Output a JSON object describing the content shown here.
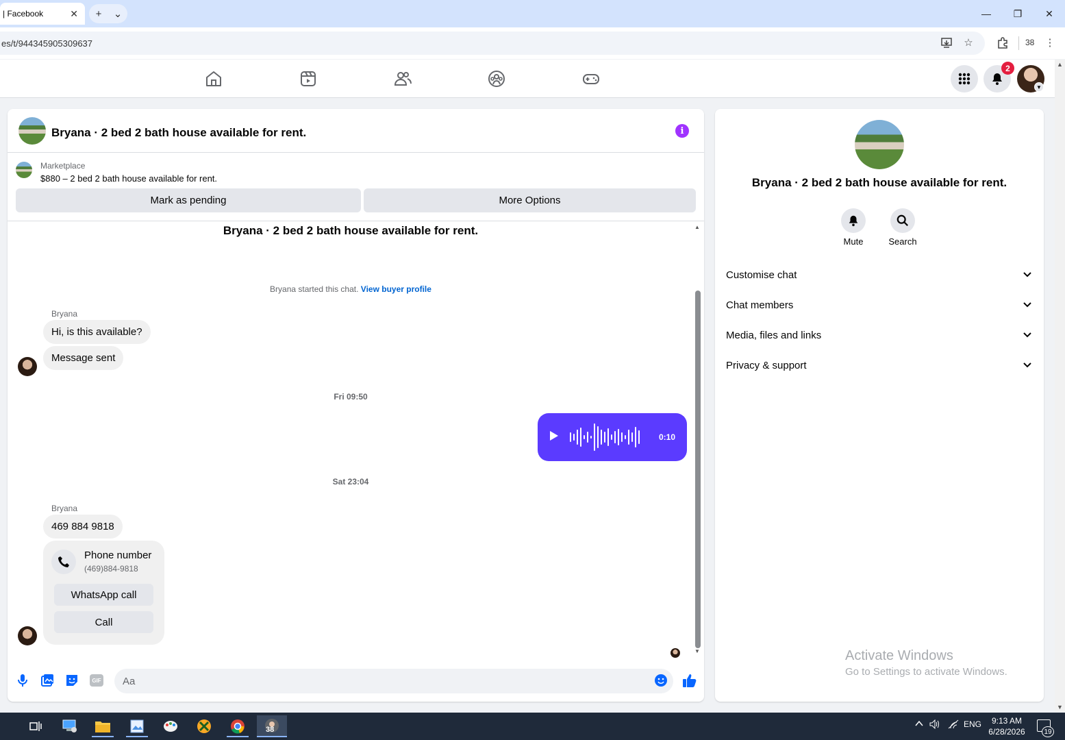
{
  "browser": {
    "tab_title": "| Facebook",
    "tab_close": "✕",
    "new_tab": "+",
    "tab_menu": "⌄",
    "url": "es/t/944345905309637",
    "extension_count": "38",
    "window_controls": {
      "minimize": "—",
      "restore": "❐",
      "close": "✕"
    }
  },
  "fb_nav": {
    "icons": [
      "home-icon",
      "video-icon",
      "friends-icon",
      "groups-icon",
      "gaming-icon"
    ],
    "notification_count": "2",
    "accent": "#0866ff"
  },
  "chat": {
    "title": "Bryana · 2 bed 2 bath house available for rent.",
    "marketplace_label": "Marketplace",
    "listing": "$880 – 2 bed 2 bath house available for rent.",
    "mark_pending": "Mark as pending",
    "more_options": "More Options",
    "conversation_title": "Bryana · 2 bed 2 bath house available for rent.",
    "started_text": "Bryana started this chat. ",
    "view_buyer_profile": "View buyer profile",
    "messages": [
      {
        "sender": "Bryana",
        "text": "Hi, is this available?"
      },
      {
        "text": "Message sent"
      }
    ],
    "timestamp1": "Fri 09:50",
    "voice_duration": "0:10",
    "voice_color": "#5b3bff",
    "timestamp2": "Sat 23:04",
    "sender2": "Bryana",
    "phone_message": "469 884 9818",
    "phone_card": {
      "title": "Phone number",
      "number": "(469)884-9818",
      "whatsapp": "WhatsApp call",
      "call": "Call"
    },
    "composer_placeholder": "Aa",
    "composer_gif": "GIF"
  },
  "info_panel": {
    "title": "Bryana · 2 bed 2 bath house available for rent.",
    "mute": "Mute",
    "search": "Search",
    "sections": [
      "Customise chat",
      "Chat members",
      "Media, files and links",
      "Privacy & support"
    ],
    "watermark_title": "Activate Windows",
    "watermark_sub": "Go to Settings to activate Windows."
  },
  "taskbar": {
    "lang": "ENG",
    "time": "9:13 AM",
    "date": "6/28/2026",
    "notification_count": "19",
    "chrome_badge": "38"
  }
}
